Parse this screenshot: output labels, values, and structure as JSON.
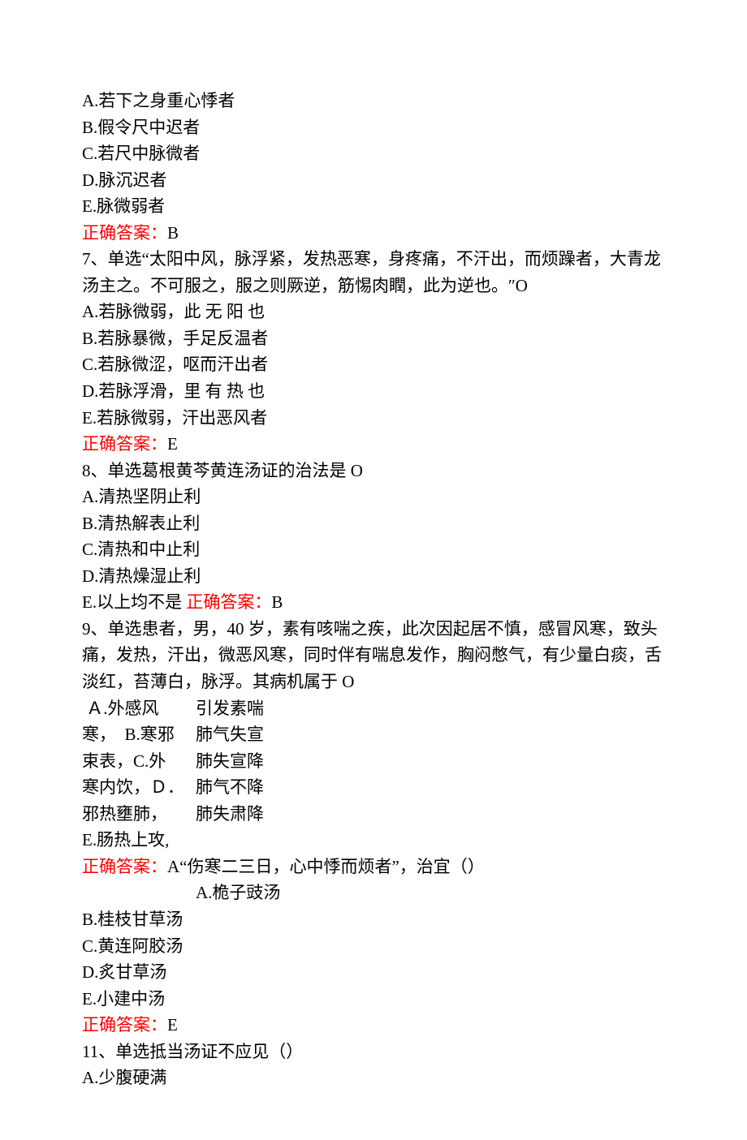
{
  "q6": {
    "optA": "A.若下之身重心悸者",
    "optB": "B.假令尺中迟者",
    "optC": "C.若尺中脉微者",
    "optD": "D.脉沉迟者",
    "optE": "E.脉微弱者",
    "answerLabel": "正确答案：",
    "answerVal": "B"
  },
  "q7": {
    "stem1": "7、单选“太阳中风，脉浮紧，发热恶寒，身疼痛，不汗出，而烦躁者，大青龙",
    "stem2": "汤主之。不可服之，服之则厥逆，筋惕肉瞤，此为逆也。″O",
    "optA": "A.若脉微弱，此 无 阳 也",
    "optB": "B.若脉暴微，手足反温者",
    "optC": "C.若脉微涩，呕而汗出者",
    "optD": "D.若脉浮滑，里 有 热 也",
    "optE": "E.若脉微弱，汗出恶风者",
    "answerLabel": "正确答案：",
    "answerVal": "E"
  },
  "q8": {
    "stem": "8、单选葛根黄芩黄连汤证的治法是 O",
    "optA": "A.清热坚阴止利",
    "optB": "B.清热解表止利",
    "optC": "C.清热和中止利",
    "optD": "D.清热燥湿止利",
    "optEprefix": "E.以上均不是 ",
    "answerLabel": "正确答案：",
    "answerVal": "B"
  },
  "q9": {
    "stem1": "9、单选患者，男，40 岁，素有咳喘之疾，此次因起居不慎，感冒风寒，致头",
    "stem2": "痛，发热，汗出，微恶风寒，同时伴有喘息发作，胸闷憋气，有少量白痰，舌",
    "stem3": "淡红，苔薄白，脉浮。其病机属于 O",
    "col1A": " Ａ.外感风",
    "col2A": "引发素喘",
    "col1B": "寒，  B.寒邪",
    "col2B": "肺气失宣",
    "col1C": "束表，C.外",
    "col2C": "肺失宣降",
    "col1D": "寒内饮，Ｄ．",
    "col2D": "肺气不降",
    "col1E": "邪热壅肺，",
    "col2E": "肺失肃降",
    "optF": "E.肠热上攻,",
    "answerLabel": "正确答案：",
    "answerVal": "A",
    "extraStem": "“伤寒二三日，心中悸而烦者”，治宜（）",
    "extraOptA": "A.桅子豉汤",
    "optBB": "B.桂枝甘草汤",
    "optCC": "C.黄连阿胶汤",
    "optDD": "D.炙甘草汤",
    "optEE": "E.小建中汤",
    "answerLabel2": "正确答案：",
    "answerVal2": "E"
  },
  "q11": {
    "stem": "11、单选抵当汤证不应见（）",
    "optA": "A.少腹硬满"
  }
}
